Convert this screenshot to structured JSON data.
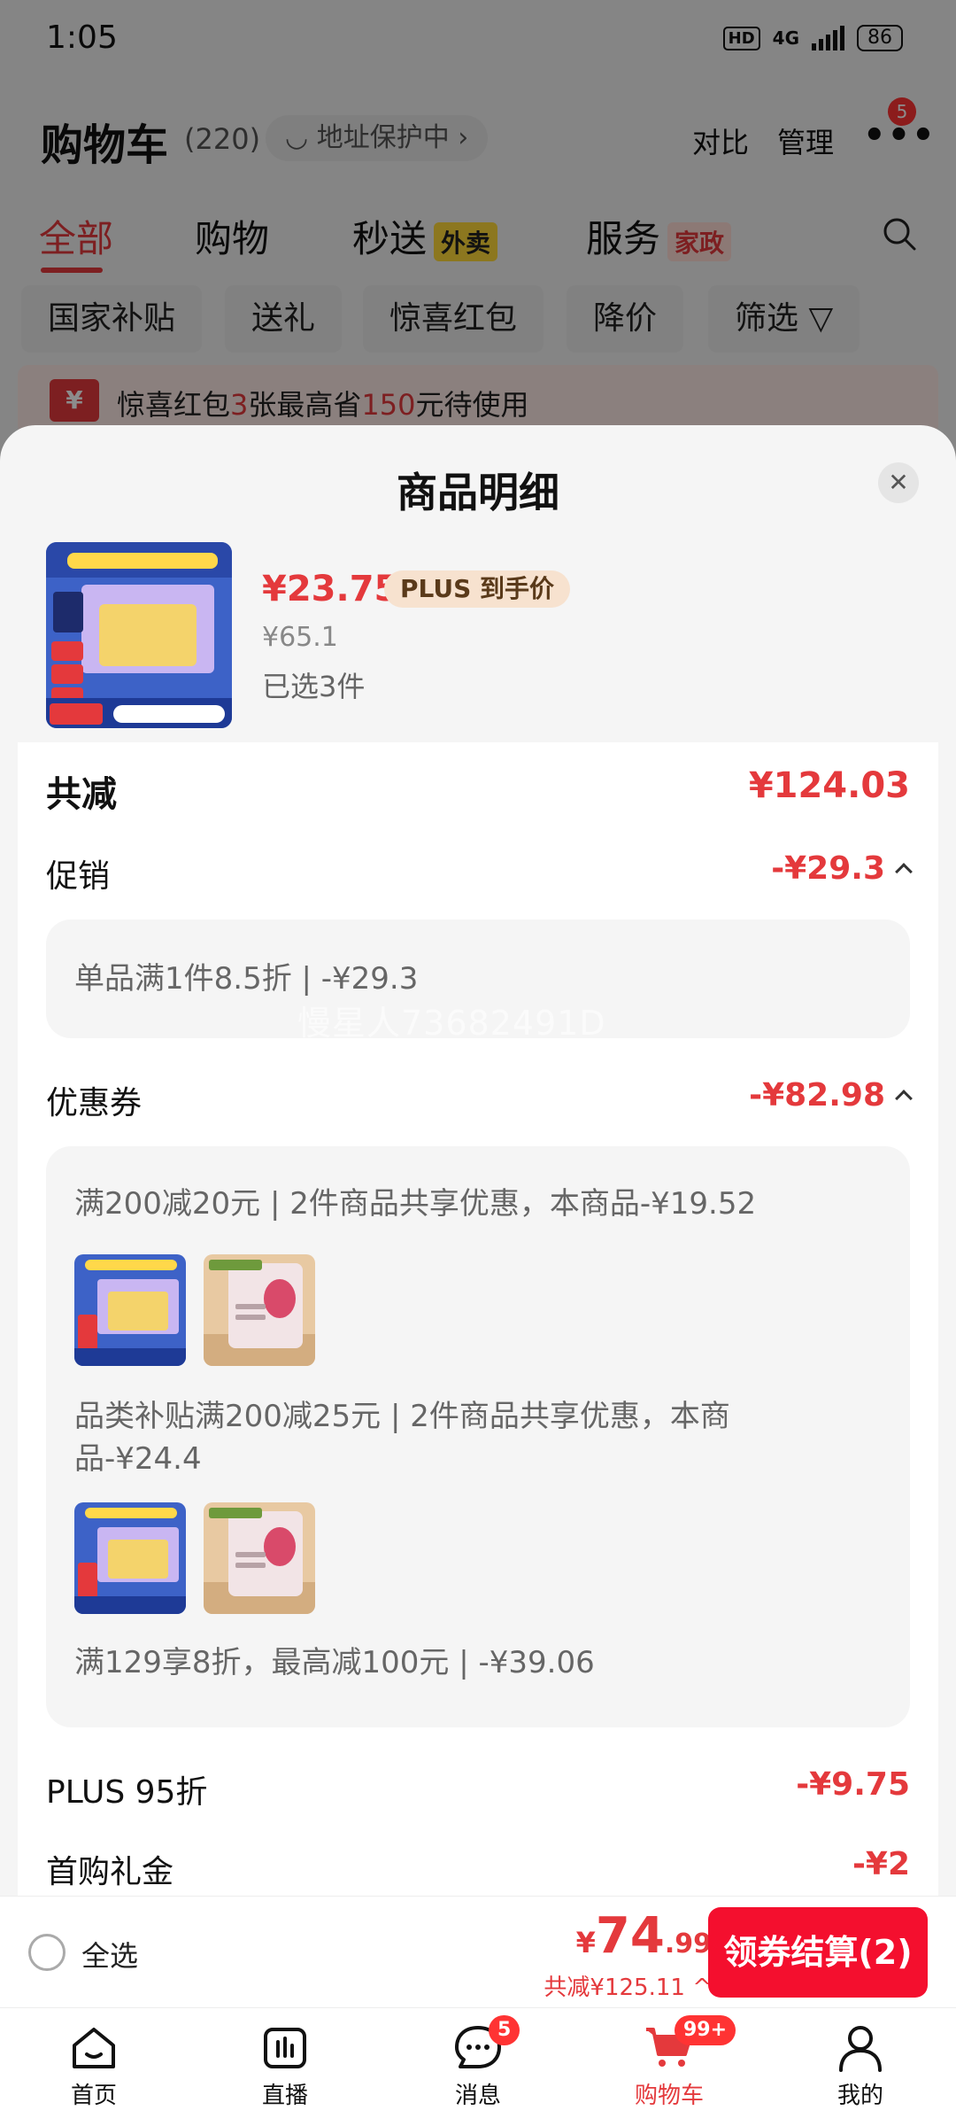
{
  "status": {
    "time": "1:05",
    "hd": "HD",
    "network": "4G",
    "battery": "86"
  },
  "header": {
    "title": "购物车",
    "count": "(220)",
    "address_pill": "地址保护中 ›",
    "compare": "对比",
    "manage": "管理",
    "more_badge": "5"
  },
  "tabs": [
    {
      "label": "全部"
    },
    {
      "label": "购物"
    },
    {
      "label": "秒送",
      "tag": "外卖"
    },
    {
      "label": "服务",
      "tag": "家政"
    }
  ],
  "chips": [
    "国家补贴",
    "送礼",
    "惊喜红包",
    "降价",
    "筛选 ▽"
  ],
  "promo": {
    "pre": "惊喜红包",
    "n1": "3",
    "mid": "张最高省",
    "n2": "150",
    "post": "元待使用"
  },
  "sheet": {
    "title": "商品明细",
    "close": "✕",
    "product": {
      "price": "¥23.75",
      "plus_tag": "PLUS 到手价",
      "original": "¥65.1",
      "selected": "已选3件"
    },
    "total_reduce": {
      "label": "共减",
      "value": "¥124.03"
    },
    "promotion": {
      "label": "促销",
      "value": "-¥29.3",
      "detail": "单品满1件8.5折 | -¥29.3"
    },
    "coupon": {
      "label": "优惠券",
      "value": "-¥82.98",
      "details": [
        "满200减20元 | 2件商品共享优惠，本商品-¥19.52",
        "品类补贴满200减25元 | 2件商品共享优惠，本商品-¥24.4",
        "满129享8折，最高减100元 | -¥39.06"
      ],
      "detail2_line1": "品类补贴满200减25元 | 2件商品共享优惠，本商",
      "detail2_line2": "品-¥24.4"
    },
    "plus": {
      "label": "PLUS 95折",
      "value": "-¥9.75"
    },
    "first_buy": {
      "label": "首购礼金",
      "value": "-¥2"
    }
  },
  "watermark": "慢星人73682491D",
  "checkout": {
    "select_all": "全选",
    "currency": "¥",
    "price_int": "74",
    "price_dec": ".99",
    "save": "共减¥125.11 ^",
    "button": "领券结算(2)"
  },
  "tabbar": [
    {
      "label": "首页",
      "icon": "home-icon"
    },
    {
      "label": "直播",
      "icon": "live-icon"
    },
    {
      "label": "消息",
      "icon": "message-icon",
      "badge": "5"
    },
    {
      "label": "购物车",
      "icon": "cart-icon",
      "badge": "99+"
    },
    {
      "label": "我的",
      "icon": "profile-icon"
    }
  ],
  "colors": {
    "accent": "#e4393c",
    "button": "#f40f2e",
    "plus_tag_bg": "#f7e2cf"
  }
}
